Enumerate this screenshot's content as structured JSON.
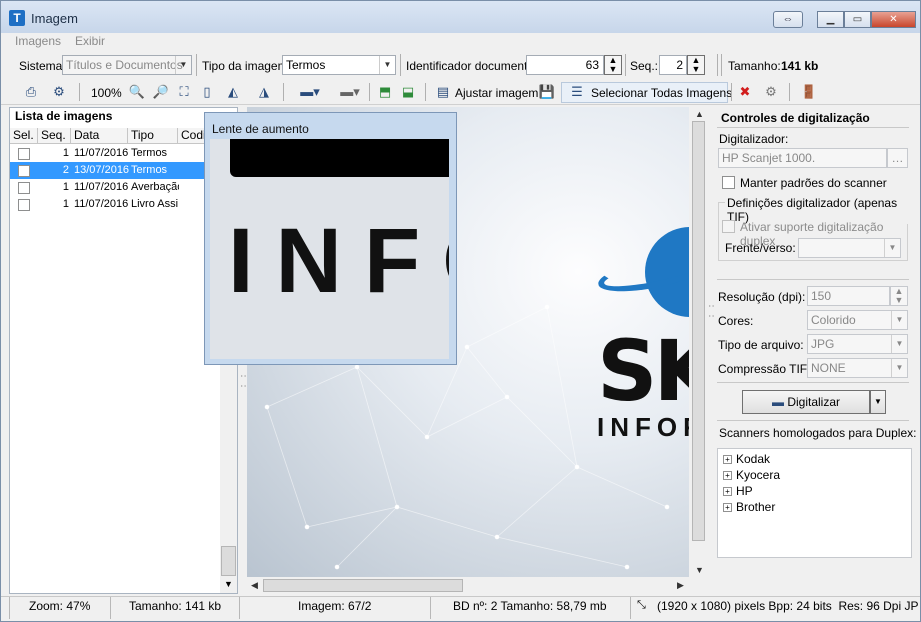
{
  "window": {
    "title": "Imagem",
    "app_icon_letter": "T"
  },
  "menu": [
    "Imagens",
    "Exibir"
  ],
  "fields": {
    "sistema_label": "Sistema:",
    "sistema_value": "Títulos e Documentos",
    "tipo_label": "Tipo da imagem:",
    "tipo_value": "Termos",
    "identificador_label": "Identificador documento:",
    "identificador_value": "63",
    "seq_label": "Seq.:",
    "seq_value": "2",
    "tamanho_label": "Tamanho:",
    "tamanho_value": "141 kb"
  },
  "toolbar": {
    "zoom_label": "100%",
    "ajustar_label": "Ajustar imagem",
    "selecionar_label": "Selecionar Todas Imagens"
  },
  "list": {
    "title": "Lista de imagens",
    "columns": [
      "Sel.",
      "Seq.",
      "Data",
      "Tipo",
      "Codig"
    ],
    "rows": [
      {
        "seq": "1",
        "data": "11/07/2016",
        "tipo": "Termos",
        "selected": false
      },
      {
        "seq": "2",
        "data": "13/07/2016",
        "tipo": "Termos",
        "selected": true
      },
      {
        "seq": "1",
        "data": "11/07/2016",
        "tipo": "Averbação",
        "selected": false
      },
      {
        "seq": "1",
        "data": "11/07/2016",
        "tipo": "Livro Assi",
        "selected": false
      }
    ]
  },
  "magnifier": {
    "title": "Lente de aumento",
    "text": "INFO"
  },
  "image": {
    "logo_big": "SK",
    "logo_small": "INFORI"
  },
  "right_panel": {
    "title": "Controles de digitalização",
    "digitalizador_label": "Digitalizador:",
    "digitalizador_value": "HP Scanjet 1000.",
    "manter_label": "Manter padrões do scanner",
    "group_title": "Definições digitalizador (apenas TIF)",
    "duplex_label": "Ativar suporte digitalização duplex",
    "frente_label": "Frente/verso:",
    "resolucao_label": "Resolução (dpi):",
    "resolucao_value": "150",
    "cores_label": "Cores:",
    "cores_value": "Colorido",
    "tipo_arquivo_label": "Tipo de arquivo:",
    "tipo_arquivo_value": "JPG",
    "compressao_label": "Compressão TIF:",
    "compressao_value": "NONE",
    "digitalizar_label": "Digitalizar",
    "homologados_label": "Scanners homologados para Duplex:",
    "scanners": [
      "Kodak",
      "Kyocera",
      "HP",
      "Brother"
    ]
  },
  "status": {
    "zoom": "Zoom: 47%",
    "tamanho": "Tamanho: 141 kb",
    "imagem": "Imagem: 67/2",
    "bd": "BD nº: 2 Tamanho: 58,79 mb",
    "info": "(1920 x 1080) pixels Bpp: 24 bits  Res: 96 Dpi JP"
  },
  "colors": {
    "selection": "#3399ff",
    "logo_blue": "#1f78c4"
  }
}
